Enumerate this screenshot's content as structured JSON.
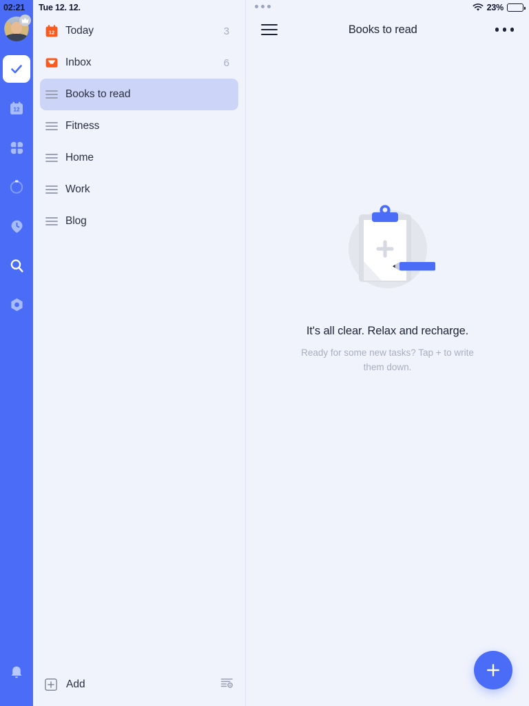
{
  "statusbar": {
    "time": "02:21",
    "date": "Tue 12. 12.",
    "battery_percent": "23%",
    "battery_level": 23,
    "wifi_icon": "wifi-icon",
    "overflow_icon": "three-dots-icon"
  },
  "rail": {
    "avatar": {
      "name": "user-avatar",
      "badge_icon": "crown-badge-icon"
    },
    "items": [
      {
        "icon": "tasks-check-icon",
        "active": true
      },
      {
        "icon": "calendar-12-icon",
        "active": false
      },
      {
        "icon": "grid-quadrants-icon",
        "active": false
      },
      {
        "icon": "progress-ring-icon",
        "active": false
      },
      {
        "icon": "clock-pin-icon",
        "active": false
      },
      {
        "icon": "search-icon",
        "active": false
      },
      {
        "icon": "settings-hex-icon",
        "active": false
      }
    ],
    "bell_icon": "bell-icon"
  },
  "list": {
    "items": [
      {
        "label": "Today",
        "count": "3",
        "icon": "calendar-today-icon",
        "selected": false
      },
      {
        "label": "Inbox",
        "count": "6",
        "icon": "inbox-tray-icon",
        "selected": false
      },
      {
        "label": "Books to read",
        "count": "",
        "icon": "list-lines-icon",
        "selected": true
      },
      {
        "label": "Fitness",
        "count": "",
        "icon": "list-lines-icon",
        "selected": false
      },
      {
        "label": "Home",
        "count": "",
        "icon": "list-lines-icon",
        "selected": false
      },
      {
        "label": "Work",
        "count": "",
        "icon": "list-lines-icon",
        "selected": false
      },
      {
        "label": "Blog",
        "count": "",
        "icon": "list-lines-icon",
        "selected": false
      }
    ],
    "add_label": "Add",
    "add_icon": "plus-square-icon",
    "sort_icon": "sort-settings-icon"
  },
  "main": {
    "menu_icon": "hamburger-menu-icon",
    "title": "Books to read",
    "more_icon": "kebab-menu-icon",
    "empty": {
      "illustration": "clipboard-pencil-illustration",
      "title": "It's all clear. Relax and recharge.",
      "subtitle": "Ready for some new tasks? Tap + to write them down."
    },
    "fab_icon": "plus-icon"
  },
  "colors": {
    "accent_blue": "#4a6cf7",
    "accent_orange": "#fa5a1e",
    "panel_bg": "#f0f3fc",
    "selected_row": "#ccd5f7",
    "text_primary": "#1d2235",
    "text_muted": "#a9aebe"
  }
}
